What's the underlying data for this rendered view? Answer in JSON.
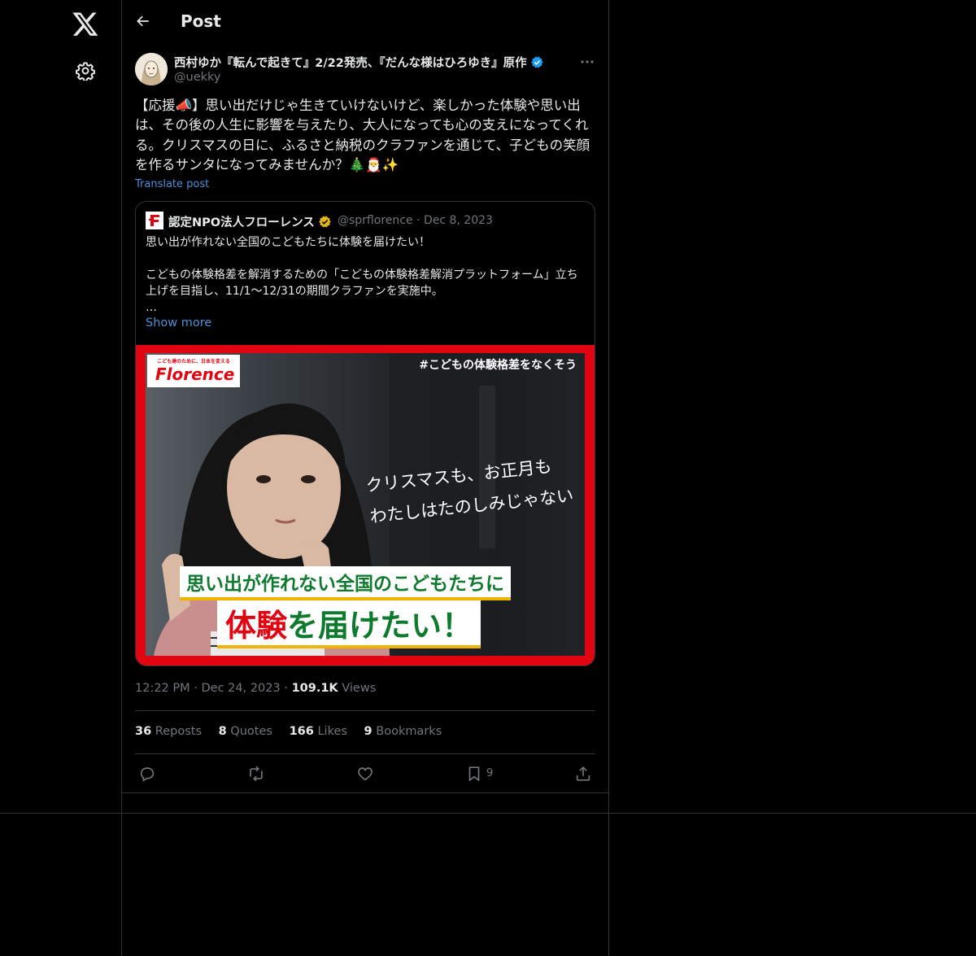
{
  "header": {
    "title": "Post"
  },
  "post": {
    "author_name": "西村ゆか『転んで起きて』2/22発売、『だんな様はひろゆき』原作",
    "handle": "@uekky",
    "text": "【応援📣】思い出だけじゃ生きていけないけど、楽しかった体験や思い出は、その後の人生に影響を与えたり、大人になっても心の支えになってくれる。クリスマスの日に、ふるさと納税のクラファンを通じて、子どもの笑顔を作るサンタになってみませんか？🎄🎅✨",
    "translate_label": "Translate post",
    "time": "12:22 PM",
    "date": "Dec 24, 2023",
    "views_count": "109.1K",
    "views_label": "Views"
  },
  "quote": {
    "name": "認定NPO法人フローレンス",
    "handle": "@sprflorence",
    "date": "Dec 8, 2023",
    "text": "思い出が作れない全国のこどもたちに体験を届けたい！\n\nこどもの体験格差を解消するための「こどもの体験格差解消プラットフォーム」立ち上げを目指し、11/1〜12/31の期間クラファンを実施中。\n…",
    "show_more": "Show more",
    "image": {
      "logo_tagline": "こども達のために、日本を変える",
      "logo_text": "Florence",
      "hashtag": "#こどもの体験格差をなくそう",
      "handwritten_1": "クリスマスも、お正月も",
      "handwritten_2": "わたしはたのしみじゃない",
      "banner_1": "思い出が作れない全国のこどもたちに",
      "banner_2_red": "体験",
      "banner_2_rest": "を届けたい！"
    }
  },
  "stats": [
    {
      "count": "36",
      "label": "Reposts"
    },
    {
      "count": "8",
      "label": "Quotes"
    },
    {
      "count": "166",
      "label": "Likes"
    },
    {
      "count": "9",
      "label": "Bookmarks"
    }
  ],
  "actions": {
    "bookmark_count": "9"
  },
  "colors": {
    "background": "#000000",
    "border": "#2f3336",
    "text": "#e7e9ea",
    "muted": "#71767b",
    "link": "#4d90d6",
    "verified_blue": "#1d9bf0",
    "verified_gold": "#e2b719",
    "florence_red": "#e00510",
    "banner_green": "#0e7a2e"
  },
  "icons": [
    "x-logo-icon",
    "settings-icon",
    "back-arrow-icon",
    "verified-icon",
    "more-icon",
    "reply-icon",
    "repost-icon",
    "like-icon",
    "bookmark-icon",
    "share-icon"
  ]
}
